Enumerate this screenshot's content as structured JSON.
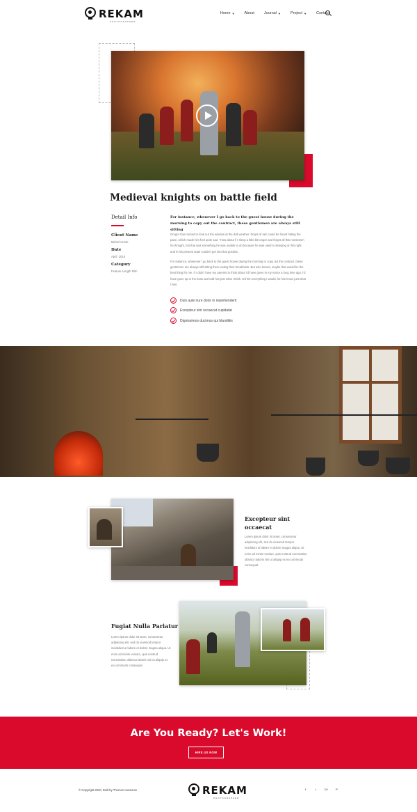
{
  "brand": {
    "name": "REKAM",
    "tagline": "PHOTOGRAPHER"
  },
  "nav": {
    "items": [
      {
        "label": "Home",
        "dropdown": true
      },
      {
        "label": "About",
        "dropdown": false
      },
      {
        "label": "Journal",
        "dropdown": true
      },
      {
        "label": "Project",
        "dropdown": true
      },
      {
        "label": "Contact",
        "dropdown": false
      }
    ],
    "search_icon": "search-icon"
  },
  "project": {
    "title": "Medieval knights on battle field",
    "detail_heading": "Detail Info",
    "details": [
      {
        "label": "Client Name",
        "value": "Michel Crook"
      },
      {
        "label": "Date",
        "value": "April, 2015"
      },
      {
        "label": "Category",
        "value": "Feature Length Film"
      }
    ],
    "lead": "For instance, whenever I go back to the guest house during the morning to copy out the contract, these gentlemen are always still sitting",
    "paragraphs": [
      "Gregor then turned to look out the window at the dull weather. Drops of rain could be heard hitting the pane, which made him feel quite sad. \"How about if I sleep a little bit longer and forget all this nonsense\", he thought, but that was something he was unable to do because he was used to sleeping on his right, and in his present state couldn't get into that position.",
      "For instance, whenever I go back to the guest house during the morning to copy out the contract, these gentlemen are always still sitting there eating their breakfasts. But who knows, maybe that would be the best thing for me. If I didn't have my parents to think about I'd have given in my notice a long time ago, I'd have gone up to the boss and told him just what I think, tell him everything I would, let him know just what I feel."
    ],
    "checklist": [
      "Duis aute irure dolor in reprehenderit",
      "Excepteur sint occaecat cupidatat",
      "Dignissimos ducimus qui blanditiis"
    ]
  },
  "features": [
    {
      "title": "Excepteur sint occaecat",
      "text": "Lorem ipsum dolor sit amet, consectetur adipiscing elit, sed do eiusmod tempor incididunt ut labore et dolore magna aliqua. Ut enim ad minim veniam, quis nostrud exercitation ullamco laboris nisi ut aliquip ex ea commodo consequat."
    },
    {
      "title": "Fugiat Nulla Pariatur",
      "text": "Lorem ipsum dolor sit amet, consectetur adipiscing elit, sed do eiusmod tempor incididunt ut labore et dolore magna aliqua. Ut enim ad minim veniam, quis nostrud exercitation ullamco laboris nisi ut aliquip ex ea commodo consequat."
    }
  ],
  "cta": {
    "title": "Are You Ready? Let's Work!",
    "button": "HIRE US NOW"
  },
  "footer": {
    "copyright": "© Copyright 2020, Built by Themes Awesome",
    "social": [
      "f",
      "t",
      "G+",
      "P"
    ]
  },
  "colors": {
    "accent": "#d90a2c"
  }
}
